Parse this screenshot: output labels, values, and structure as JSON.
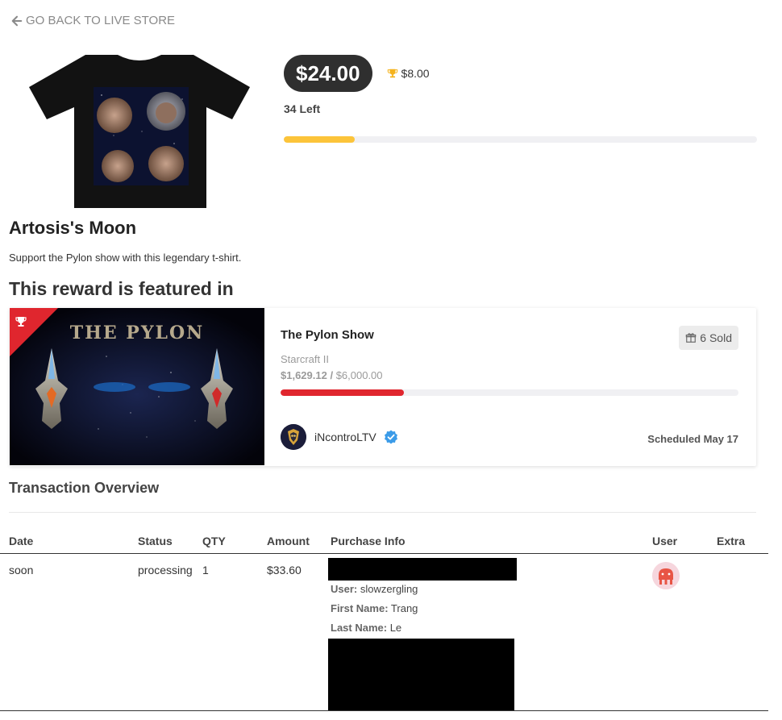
{
  "nav": {
    "back_label": "GO BACK TO LIVE STORE"
  },
  "product": {
    "price": "$24.00",
    "trophy_price": "$8.00",
    "left_text": "34 Left",
    "stock_progress_pct": 15,
    "title": "Artosis's Moon",
    "description": "Support the Pylon show with this legendary t-shirt.",
    "image": "t-shirt-image"
  },
  "featured": {
    "heading": "This reward is featured in",
    "card": {
      "image_text": "THE PYLON",
      "title": "The Pylon Show",
      "sold": "6 Sold",
      "game": "Starcraft II",
      "raised_amount": "$1,629.12 /",
      "raised_goal": "$6,000.00",
      "raise_progress_pct": 27,
      "streamer": "iNcontroLTV",
      "scheduled": "Scheduled May 17"
    }
  },
  "transactions": {
    "title": "Transaction Overview",
    "headers": {
      "date": "Date",
      "status": "Status",
      "qty": "QTY",
      "amount": "Amount",
      "purchase_info": "Purchase Info",
      "user": "User",
      "extra": "Extra"
    },
    "rows": [
      {
        "date": "soon",
        "status": "processing",
        "qty": "1",
        "amount": "$33.60",
        "user_label": "User:",
        "user_value": "slowzergling",
        "first_label": "First Name:",
        "first_value": "Trang",
        "last_label": "Last Name:",
        "last_value": "Le"
      }
    ]
  },
  "colors": {
    "price_pill": "#2f2f2f",
    "stock_bar": "#fcc43a",
    "raise_bar": "#e0262e",
    "trophy": "#f5b31c",
    "verified": "#3b9be8"
  }
}
